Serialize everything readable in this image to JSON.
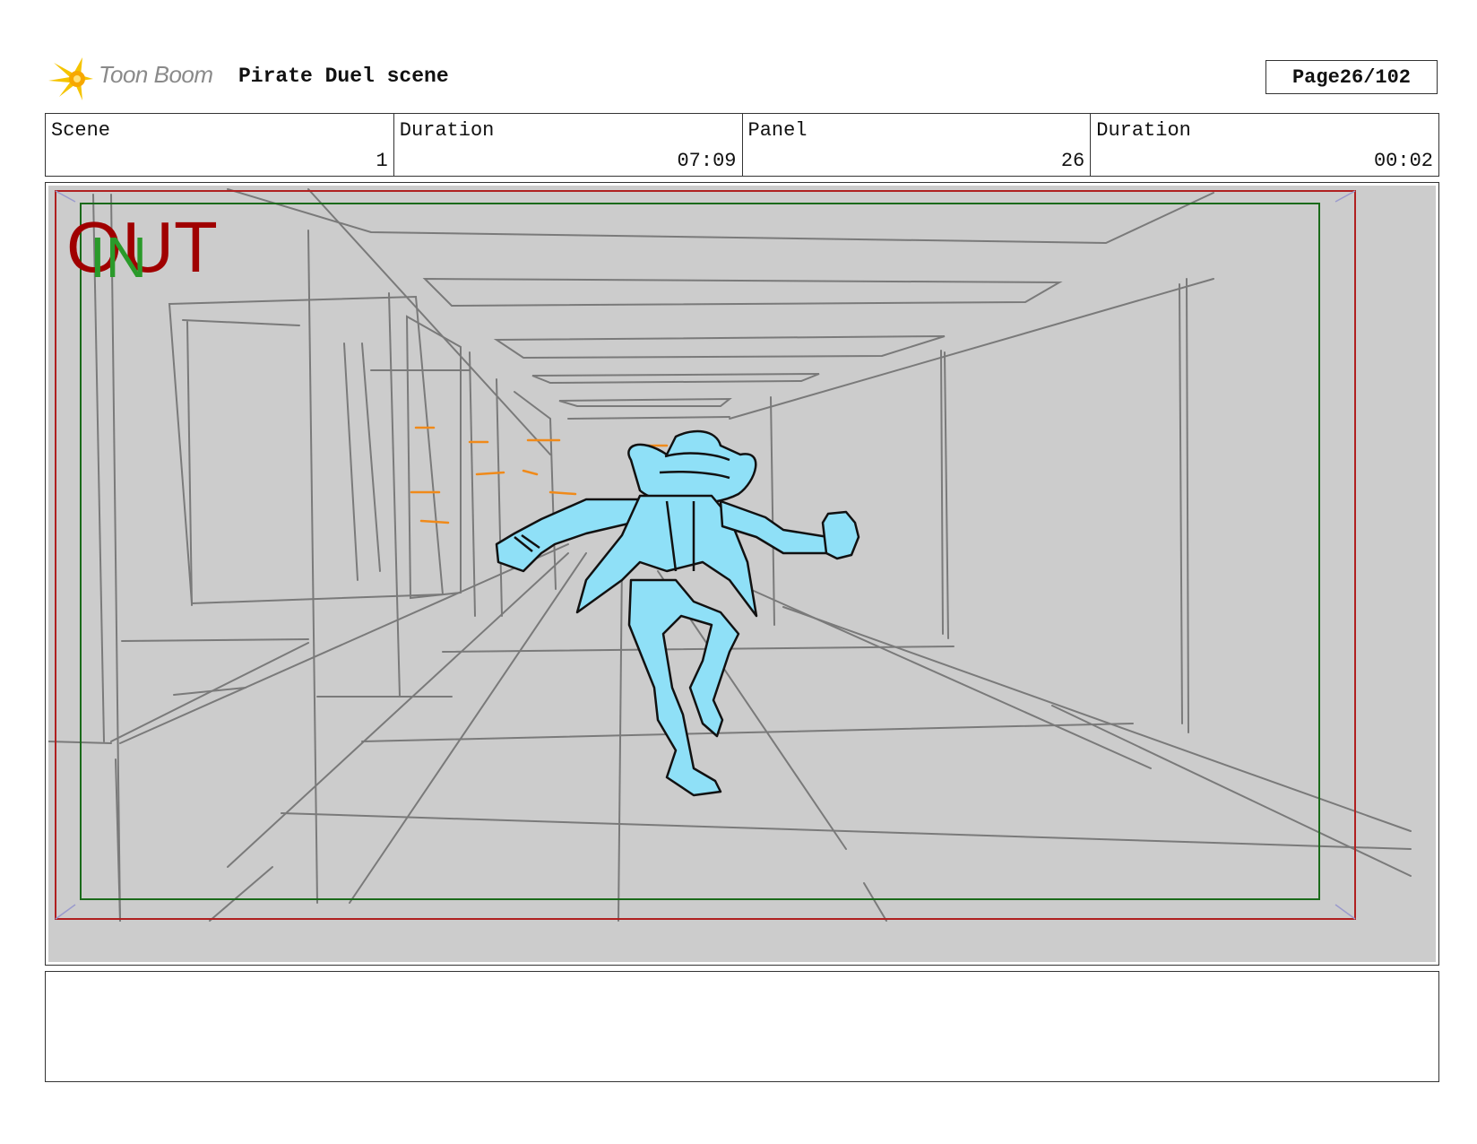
{
  "header": {
    "logo_text": "Toon Boom",
    "title": "Pirate Duel scene",
    "page_label": "Page",
    "page_value": "26/102"
  },
  "info": {
    "scene_label": "Scene",
    "scene_value": "1",
    "scene_duration_label": "Duration",
    "scene_duration_value": "07:09",
    "panel_label": "Panel",
    "panel_value": "26",
    "panel_duration_label": "Duration",
    "panel_duration_value": "00:02"
  },
  "frame_markers": {
    "out_label": "OUT",
    "in_label": "IN",
    "out_color": "#a00000",
    "in_color": "#2a9a2a"
  },
  "colors": {
    "character_fill": "#8fe0f7",
    "speed_lines": "#f08a1a",
    "background_sketch": "#7a7a7a",
    "panel_bg": "#cccccc"
  },
  "notes": {
    "text": ""
  }
}
